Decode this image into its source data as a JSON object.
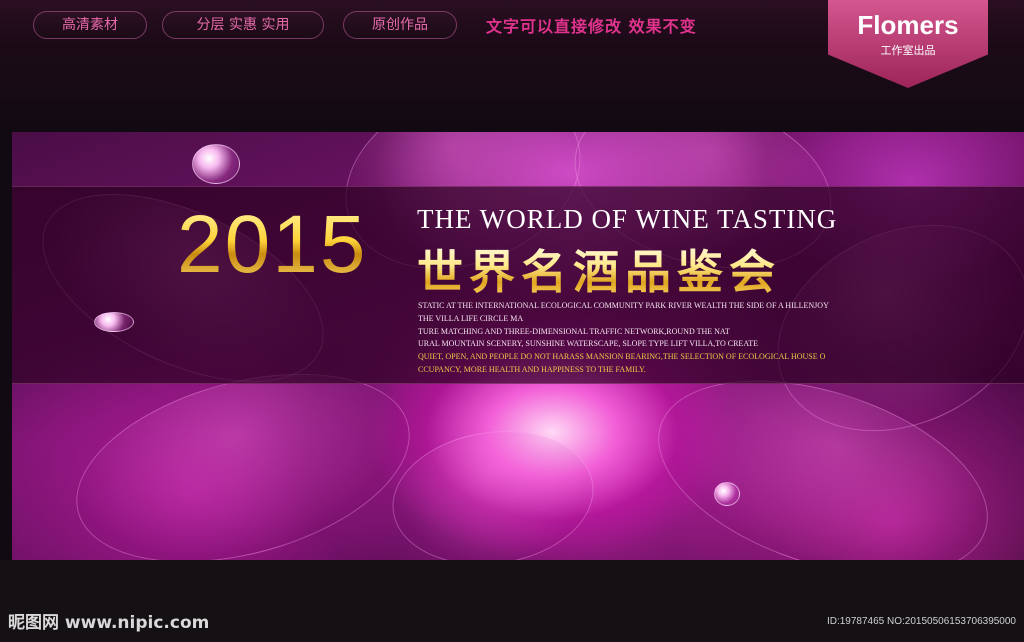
{
  "top_nav": {
    "pills": [
      "高清素材",
      "分层 实惠 实用",
      "原创作品"
    ],
    "slogan": "文字可以直接修改  效果不变",
    "badge": {
      "name": "Flomers",
      "sub": "工作室出品"
    }
  },
  "banner": {
    "year": "2015",
    "english_title": "THE WORLD OF WINE TASTING",
    "chinese_title": "世界名酒品鉴会",
    "body_lines": [
      "STATIC AT THE INTERNATIONAL ECOLOGICAL COMMUNITY PARK RIVER WEALTH THE SIDE OF A HILLENJOY",
      "THE VILLA LIFE CIRCLE MA",
      "TURE MATCHING AND THREE-DIMENSIONAL TRAFFIC NETWORK,ROUND THE NAT",
      "URAL MOUNTAIN SCENERY, SUNSHINE WATERSCAPE, SLOPE TYPE LIFT VILLA,TO CREATE",
      "QUIET, OPEN, AND PEOPLE DO NOT HARASS MANSION BEARING,THE SELECTION OF ECOLOGICAL HOUSE O",
      "CCUPANCY, MORE HEALTH AND HAPPINESS TO THE FAMILY."
    ],
    "colors": {
      "gold": "#ffd43a",
      "magenta": "#e0338d",
      "purple": "#7a1470"
    }
  },
  "footer": {
    "watermark_cn": "昵图网",
    "watermark_url": "www.nipic.com",
    "id_text": "ID:19787465 NO:20150506153706395000"
  }
}
